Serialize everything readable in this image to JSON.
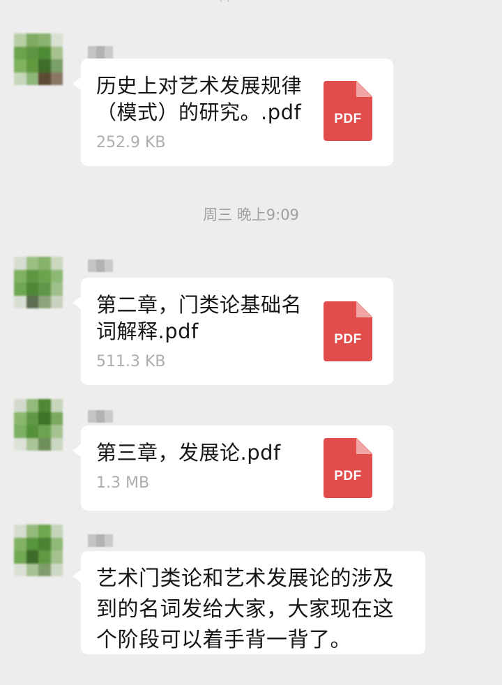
{
  "top_partial_timestamp": "· ·",
  "messages": [
    {
      "type": "file",
      "file_name": "历史上对艺术发展规律（模式）的研究。.pdf",
      "file_size": "252.9 KB",
      "file_icon": "PDF"
    },
    {
      "type": "timestamp",
      "text": "周三 晚上9:09"
    },
    {
      "type": "file",
      "file_name": "第二章，门类论基础名词解释.pdf",
      "file_size": "511.3 KB",
      "file_icon": "PDF"
    },
    {
      "type": "file",
      "file_name": "第三章，发展论.pdf",
      "file_size": "1.3 MB",
      "file_icon": "PDF"
    },
    {
      "type": "text",
      "text": "艺术门类论和艺术发展论的涉及到的名词发给大家，大家现在这个阶段可以着手背一背了。"
    }
  ],
  "colors": {
    "background": "#ededed",
    "bubble": "#ffffff",
    "pdf_red": "#e14d4b",
    "timestamp_gray": "#9f9f9f"
  }
}
